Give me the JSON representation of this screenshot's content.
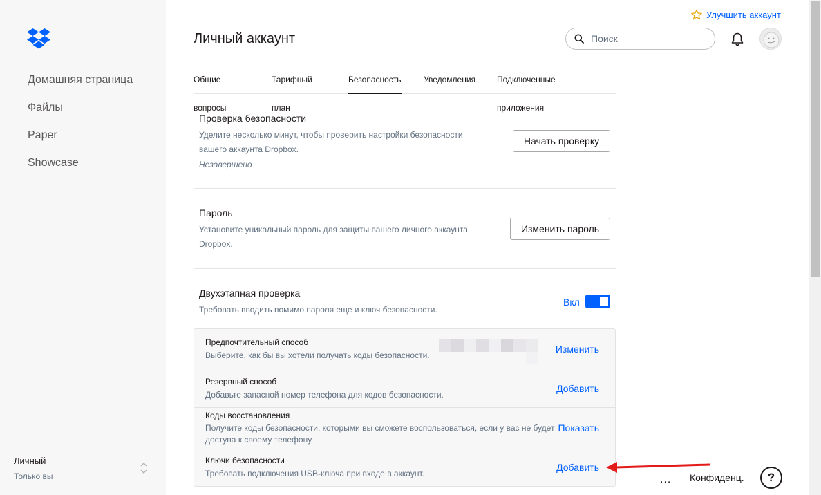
{
  "sidebar": {
    "nav": [
      "Домашняя страница",
      "Файлы",
      "Paper",
      "Showcase"
    ],
    "account_name": "Личный",
    "account_sub": "Только вы"
  },
  "header": {
    "upgrade_label": "Улучшить аккаунт",
    "title": "Личный аккаунт",
    "search_placeholder": "Поиск"
  },
  "tabs": [
    {
      "label": "Общие",
      "sub": "вопросы",
      "active": false
    },
    {
      "label": "Тарифный",
      "sub": "план",
      "active": false
    },
    {
      "label": "Безопасность",
      "sub": "",
      "active": true
    },
    {
      "label": "Уведомления",
      "sub": "",
      "active": false
    },
    {
      "label": "Подключенные",
      "sub": "приложения",
      "active": false
    }
  ],
  "security_checkup": {
    "title": "Проверка безопасности",
    "desc_line1": "Уделите несколько минут, чтобы проверить настройки безопасности",
    "desc_line2": "вашего аккаунта Dropbox.",
    "status": "Незавершено",
    "button": "Начать проверку"
  },
  "password": {
    "title": "Пароль",
    "desc_line1": "Установите уникальный пароль для защиты вашего личного аккаунта",
    "desc_line2": "Dropbox.",
    "button": "Изменить пароль"
  },
  "two_step": {
    "title": "Двухэтапная проверка",
    "desc": "Требовать вводить помимо пароля еще и ключ безопасности.",
    "toggle_label": "Вкл",
    "enabled": true,
    "rows": [
      {
        "title": "Предпочтительный способ",
        "desc": "Выберите, как бы вы хотели получать коды безопасности.",
        "link": "Изменить"
      },
      {
        "title": "Резервный способ",
        "desc": "Добавьте запасной номер телефона для кодов безопасности.",
        "link": "Добавить"
      },
      {
        "title": "Коды восстановления",
        "desc": "Получите коды безопасности, которыми вы сможете воспользоваться, если у вас не будет доступа к своему телефону.",
        "link": "Показать"
      },
      {
        "title": "Ключи безопасности",
        "desc": "Требовать подключения USB-ключа при входе в аккаунт.",
        "link": "Добавить"
      }
    ]
  },
  "footer": {
    "more": "...",
    "privacy": "Конфиденц.",
    "help": "?"
  },
  "colors": {
    "accent": "#0061fe",
    "arrow": "#e31b1b",
    "sidebar_bg": "#f7f7f7"
  },
  "icons": [
    "dropbox-logo-icon",
    "star-icon",
    "search-icon",
    "bell-icon",
    "avatar-icon",
    "chevron-updown-icon",
    "help-icon",
    "arrow-annotation-icon"
  ]
}
